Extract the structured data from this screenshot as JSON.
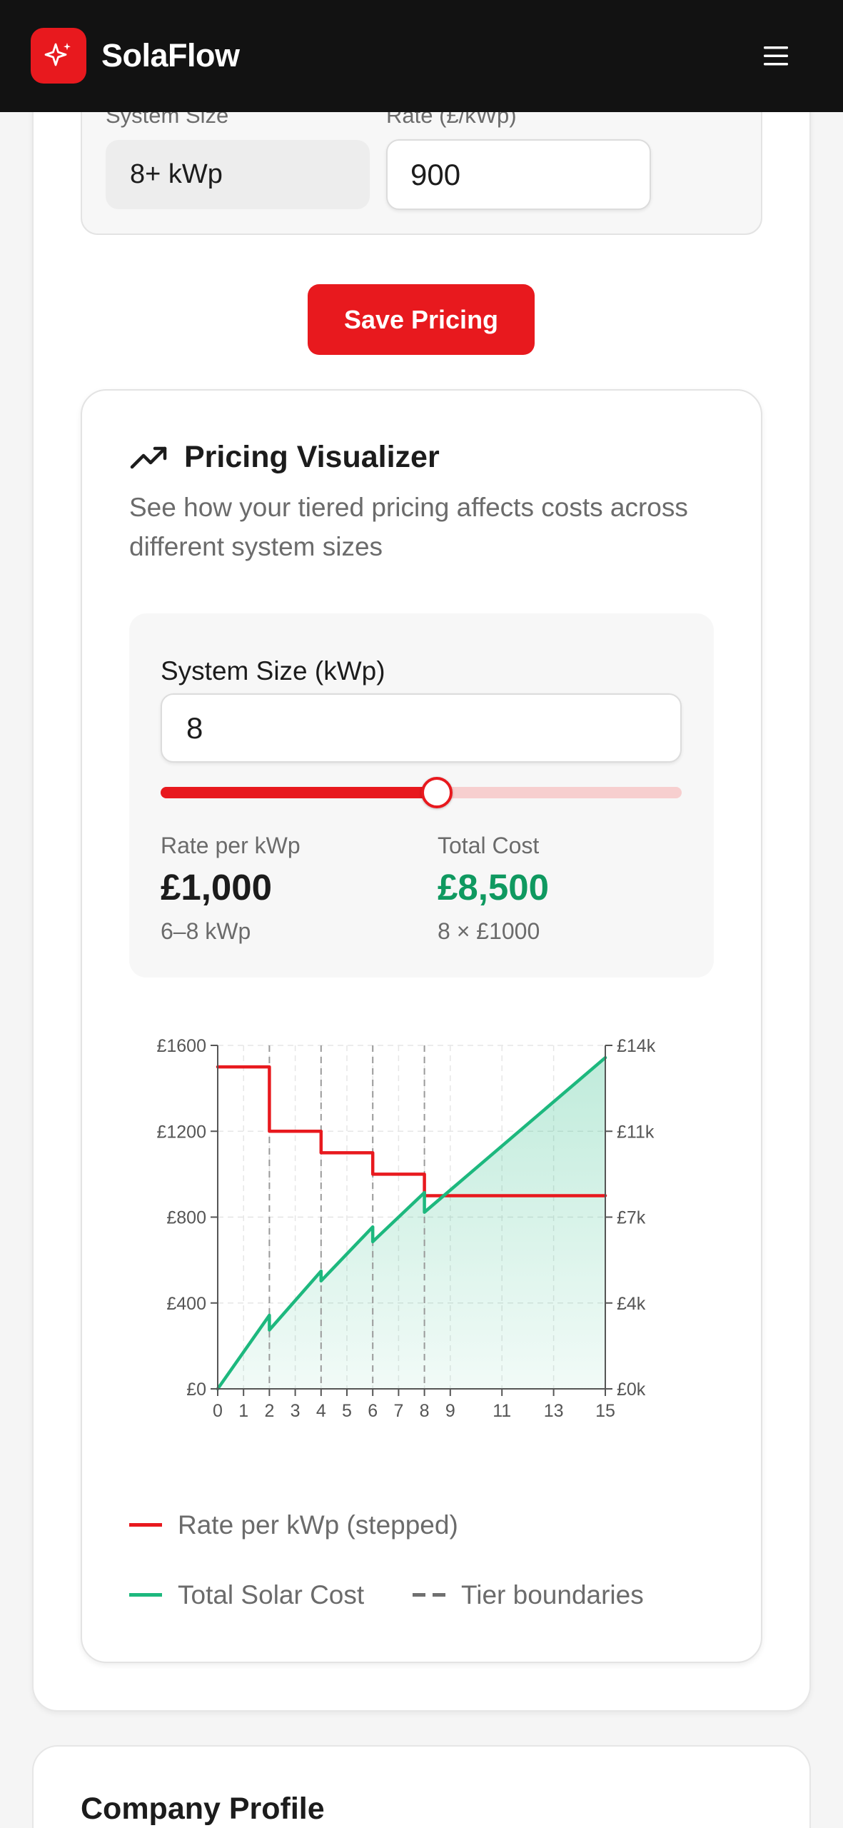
{
  "app": {
    "name": "SolaFlow"
  },
  "tier": {
    "size_label": "System Size",
    "rate_label": "Rate (£/kWp)",
    "size_value": "8+ kWp",
    "rate_value": "900"
  },
  "save_label": "Save Pricing",
  "visualizer": {
    "title": "Pricing Visualizer",
    "subtitle": "See how your tiered pricing affects costs across different system sizes",
    "size_label": "System Size (kWp)",
    "size_value": "8",
    "slider_fraction": 0.53,
    "rate_label": "Rate per kWp",
    "rate_value": "£1,000",
    "rate_range": "6–8 kWp",
    "total_label": "Total Cost",
    "total_value": "£8,500",
    "total_formula": "8 × £1000"
  },
  "chart_data": {
    "type": "line",
    "x_ticks": [
      "0",
      "1",
      "2",
      "3",
      "4",
      "5",
      "6",
      "7",
      "8",
      "9",
      "11",
      "13",
      "15"
    ],
    "y_left_ticks": [
      "£0",
      "£400",
      "£800",
      "£1200",
      "£1600"
    ],
    "y_right_ticks": [
      "£0k",
      "£4k",
      "£7k",
      "£11k",
      "£14k"
    ],
    "xlim": [
      0,
      15
    ],
    "ylim_left": [
      0,
      1600
    ],
    "ylim_right": [
      0,
      14000
    ],
    "tier_boundaries": [
      2,
      4,
      6,
      8
    ],
    "grid": true,
    "series": [
      {
        "name": "Rate per kWp (stepped)",
        "axis": "left",
        "color": "#e8191e",
        "points": [
          [
            0,
            1500
          ],
          [
            2,
            1500
          ],
          [
            2,
            1200
          ],
          [
            4,
            1200
          ],
          [
            4,
            1100
          ],
          [
            6,
            1100
          ],
          [
            6,
            1000
          ],
          [
            8,
            1000
          ],
          [
            8,
            900
          ],
          [
            15,
            900
          ]
        ]
      },
      {
        "name": "Total Solar Cost",
        "axis": "right",
        "color": "#1db87e",
        "points": [
          [
            0,
            0
          ],
          [
            2,
            3000
          ],
          [
            2,
            2400
          ],
          [
            4,
            4800
          ],
          [
            4,
            4400
          ],
          [
            6,
            6600
          ],
          [
            6,
            6000
          ],
          [
            8,
            8000
          ],
          [
            8,
            7200
          ],
          [
            15,
            13500
          ]
        ]
      }
    ],
    "boundary_label": "Tier boundaries"
  },
  "colors": {
    "accent": "#e8191e",
    "success": "#0f9960",
    "cost_line": "#1db87e"
  },
  "profile": {
    "title": "Company Profile"
  }
}
